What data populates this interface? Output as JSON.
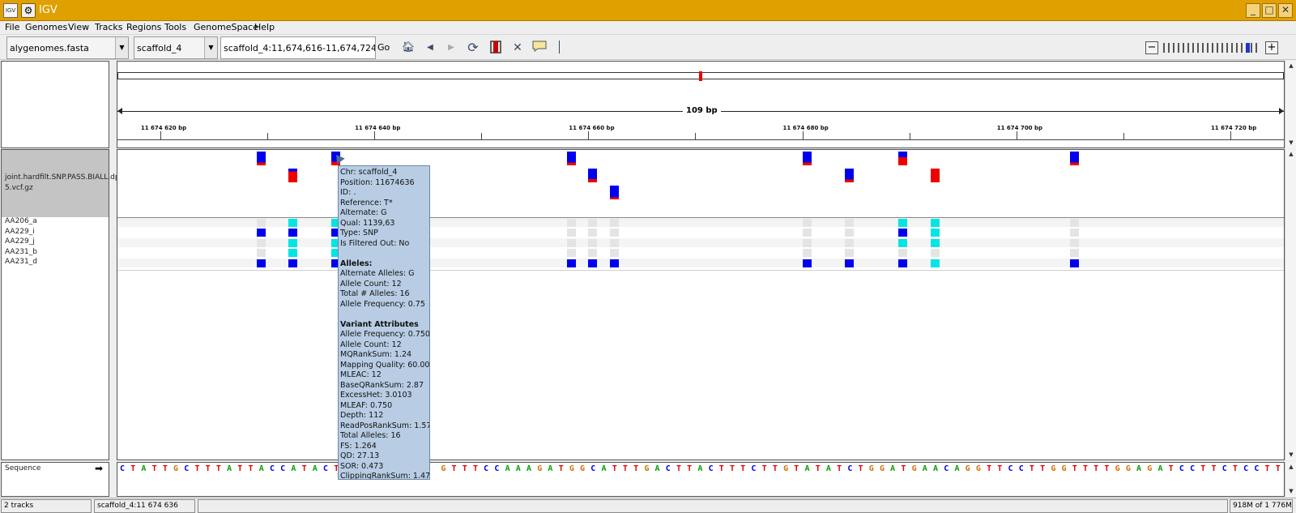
{
  "window": {
    "title": "IGV",
    "app_icon_text": "IGV",
    "minimize": "_",
    "maximize": "□",
    "close": "✕"
  },
  "menu": [
    "File",
    "Genomes",
    "View",
    "Tracks",
    "Regions",
    "Tools",
    "GenomeSpace",
    "Help"
  ],
  "toolbar": {
    "genome": "alygenomes.fasta",
    "chromosome": "scaffold_4",
    "locus": "scaffold_4:11,674,616-11,674,724",
    "go_label": "Go",
    "icons": [
      "home-icon",
      "back-icon",
      "forward-icon",
      "refresh-icon",
      "roi-icon",
      "resize-icon",
      "popup-text-icon"
    ],
    "zoom_minus": "−",
    "zoom_plus": "+",
    "zoom_level": 9,
    "zoom_levels": 10
  },
  "ruler": {
    "span_label": "109 bp",
    "tick_labels": [
      "11 674 620 bp",
      "11 674 640 bp",
      "11 674 660 bp",
      "11 674 680 bp",
      "11 674 700 bp",
      "11 674 720 bp"
    ],
    "start": 11674616,
    "end": 11674724
  },
  "variant_track": {
    "name": "joint.hardfilt.SNP.PASS.BIALL.dp4.5.vcf.gz",
    "name_line1": "joint.hardfilt.SNP.PASS.BIALL.dp4.",
    "name_line2": "5.vcf.gz",
    "colors": {
      "alt": "#0000ee",
      "ref": "#ee0000",
      "hom_var": "#0000ee",
      "het": "#00e5e5",
      "hom_ref": "#e4e4e4"
    },
    "variants": [
      {
        "pos": 11674629,
        "row": 0,
        "af": 0.8
      },
      {
        "pos": 11674632,
        "row": 1,
        "af": 0.2
      },
      {
        "pos": 11674636,
        "row": 0,
        "af": 0.75
      },
      {
        "pos": 11674658,
        "row": 0,
        "af": 0.8
      },
      {
        "pos": 11674660,
        "row": 1,
        "af": 0.75
      },
      {
        "pos": 11674662,
        "row": 2,
        "af": 0.85
      },
      {
        "pos": 11674680,
        "row": 0,
        "af": 0.8
      },
      {
        "pos": 11674684,
        "row": 1,
        "af": 0.8
      },
      {
        "pos": 11674689,
        "row": 0,
        "af": 0.4
      },
      {
        "pos": 11674692,
        "row": 1,
        "af": 0.0
      },
      {
        "pos": 11674705,
        "row": 0,
        "af": 0.8
      }
    ]
  },
  "samples": {
    "names": [
      "AA206_a",
      "AA229_i",
      "AA229_j",
      "AA231_b",
      "AA231_d"
    ],
    "genotypes": [
      [
        "hom_ref",
        "het",
        "het",
        "hom_ref",
        "hom_ref",
        "hom_ref",
        "hom_ref",
        "hom_ref",
        "het",
        "het",
        "hom_ref"
      ],
      [
        "hom_var",
        "hom_var",
        "hom_var",
        "hom_ref",
        "hom_ref",
        "hom_ref",
        "hom_ref",
        "hom_ref",
        "hom_var",
        "het",
        "hom_ref"
      ],
      [
        "hom_ref",
        "het",
        "het",
        "hom_ref",
        "hom_ref",
        "hom_ref",
        "hom_ref",
        "hom_ref",
        "het",
        "het",
        "hom_ref"
      ],
      [
        "hom_ref",
        "het",
        "het",
        "hom_ref",
        "hom_ref",
        "hom_ref",
        "hom_ref",
        "hom_ref",
        "hom_ref",
        "hom_ref",
        "hom_ref"
      ],
      [
        "hom_var",
        "hom_var",
        "hom_var",
        "hom_var",
        "hom_var",
        "hom_var",
        "hom_var",
        "hom_var",
        "hom_var",
        "het",
        "hom_var"
      ]
    ]
  },
  "popup": {
    "lines": [
      "Chr: scaffold_4",
      "Position: 11674636",
      "ID: .",
      "Reference: T*",
      "Alternate: G",
      "Qual: 1139,63",
      "Type: SNP",
      "Is Filtered Out: No",
      "",
      "Alleles:",
      "Alternate Alleles: G",
      "Allele Count: 12",
      "Total # Alleles: 16",
      "Allele Frequency: 0.75",
      "",
      "Variant Attributes",
      "Allele Frequency: 0.750",
      "Allele Count: 12",
      "MQRankSum: 1.24",
      "Mapping Quality: 60.00",
      "MLEAC: 12",
      "BaseQRankSum: 2.87",
      "ExcessHet: 3.0103",
      "MLEAF: 0.750",
      "Depth: 112",
      "ReadPosRankSum: 1.57",
      "Total Alleles: 16",
      "FS: 1.264",
      "QD: 27.13",
      "SOR: 0.473",
      "ClippingRankSum: 1.47"
    ],
    "bold": [
      "Alleles:",
      "Variant Attributes"
    ]
  },
  "sequence": {
    "label": "Sequence",
    "arrow": "➡",
    "left_bases": "CTATTGCTTTATTACCATACT",
    "right_bases": "GTTTCCAAAGATGGCATTTGACTTACTTTCTTGTATATCTGGATGAACAGGTTCCTTGGTTTTGGAGATCCTTCTCCTT",
    "colors": {
      "A": "#00a000",
      "C": "#0000e0",
      "G": "#d17105",
      "T": "#e00000"
    }
  },
  "status": {
    "tracks": "2 tracks",
    "position": "scaffold_4:11 674 636",
    "message": "",
    "memory": "918M of 1 776M"
  }
}
